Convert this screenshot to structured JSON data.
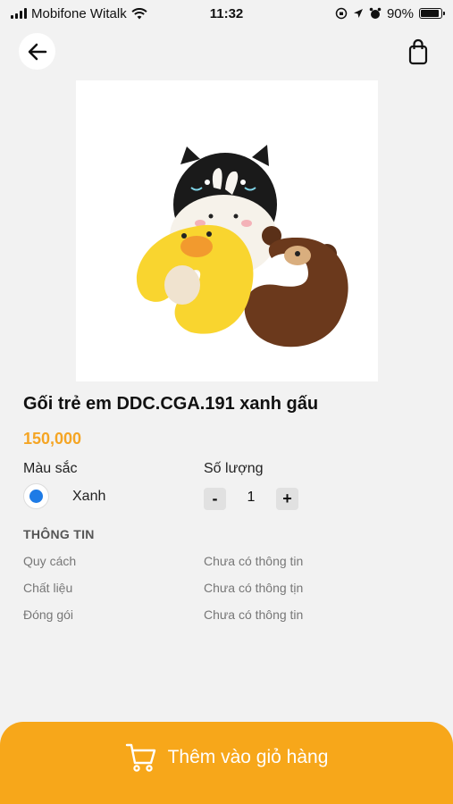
{
  "status_bar": {
    "carrier": "Mobifone Witalk",
    "time": "11:32",
    "battery": "90%",
    "battery_level": 0.9,
    "icons": [
      "signal-icon",
      "wifi-icon",
      "rotation-lock-icon",
      "location-icon",
      "alarm-icon",
      "battery-icon"
    ]
  },
  "header": {
    "back_icon": "arrow-left-icon",
    "cart_icon": "shopping-bag-icon"
  },
  "product": {
    "image": "neck-pillows-photo",
    "title": "Gối trẻ em DDC.CGA.191 xanh gấu",
    "price": "150,000"
  },
  "options": {
    "color_label": "Màu sắc",
    "quantity_label": "Số lượng",
    "selected_color": "Xanh",
    "quantity_minus": "-",
    "quantity": "1",
    "quantity_plus": "+"
  },
  "info": {
    "heading": "THÔNG TIN",
    "rows": [
      {
        "label": "Quy cách",
        "value": "Chưa có thông tin"
      },
      {
        "label": "Chất liệu",
        "value": "Chưa có thông tịn"
      },
      {
        "label": "Đóng gói",
        "value": "Chưa có thông tin"
      }
    ]
  },
  "footer": {
    "add_to_cart": "Thêm vào giỏ hàng",
    "cart_icon": "shopping-cart-icon"
  },
  "colors": {
    "accent": "#f7a71a",
    "price": "#f5a524",
    "radio": "#1e7be6",
    "background": "#f2f2f2"
  }
}
